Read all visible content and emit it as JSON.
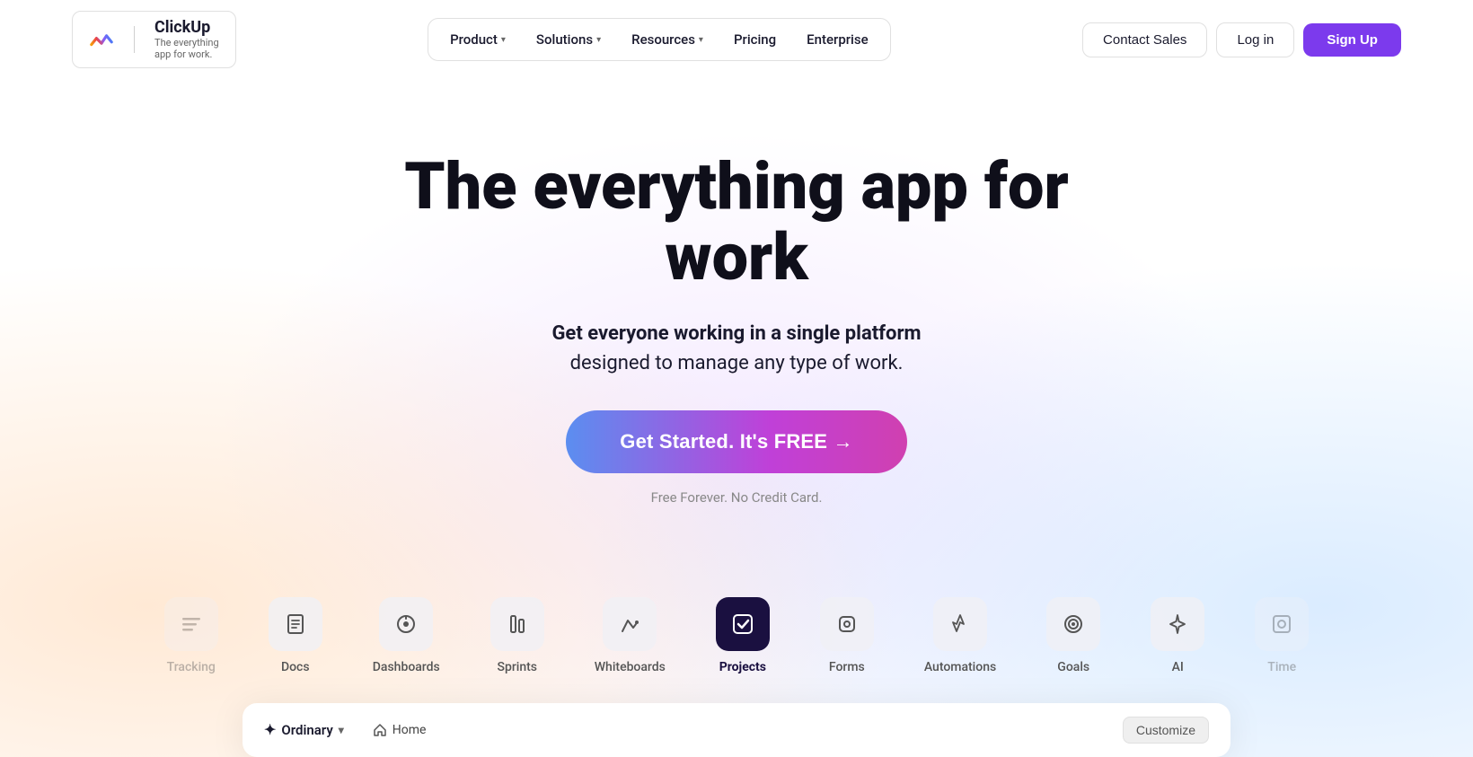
{
  "nav": {
    "logo": {
      "name": "ClickUp",
      "tagline_line1": "The everything",
      "tagline_line2": "app for work."
    },
    "items": [
      {
        "label": "Product",
        "has_dropdown": true
      },
      {
        "label": "Solutions",
        "has_dropdown": true
      },
      {
        "label": "Resources",
        "has_dropdown": true
      },
      {
        "label": "Pricing",
        "has_dropdown": false
      },
      {
        "label": "Enterprise",
        "has_dropdown": false
      }
    ],
    "buttons": {
      "contact": "Contact Sales",
      "login": "Log in",
      "signup": "Sign Up"
    }
  },
  "hero": {
    "title": "The everything app for work",
    "subtitle_strong": "Get everyone working in a single platform",
    "subtitle_rest": "designed to manage any type of work.",
    "cta_label": "Get Started. It's FREE →",
    "fine_print": "Free Forever. No Credit Card."
  },
  "feature_tabs": [
    {
      "id": "tracking",
      "label": "Tracking",
      "icon": "≡",
      "active": false,
      "partial": "left"
    },
    {
      "id": "docs",
      "label": "Docs",
      "icon": "📄",
      "active": false,
      "partial": false
    },
    {
      "id": "dashboards",
      "label": "Dashboards",
      "icon": "🎧",
      "active": false,
      "partial": false
    },
    {
      "id": "sprints",
      "label": "Sprints",
      "icon": "⊶",
      "active": false,
      "partial": false
    },
    {
      "id": "whiteboards",
      "label": "Whiteboards",
      "icon": "✏",
      "active": false,
      "partial": false
    },
    {
      "id": "projects",
      "label": "Projects",
      "icon": "✓",
      "active": true,
      "partial": false
    },
    {
      "id": "forms",
      "label": "Forms",
      "icon": "⊙",
      "active": false,
      "partial": false
    },
    {
      "id": "automations",
      "label": "Automations",
      "icon": "⚡",
      "active": false,
      "partial": false
    },
    {
      "id": "goals",
      "label": "Goals",
      "icon": "◎",
      "active": false,
      "partial": false
    },
    {
      "id": "ai",
      "label": "AI",
      "icon": "✦",
      "active": false,
      "partial": false
    },
    {
      "id": "time",
      "label": "Time",
      "icon": "⊡",
      "active": false,
      "partial": "right"
    }
  ],
  "preview": {
    "logo_label": "Ordinary",
    "nav_item": "Home",
    "customize_label": "Customize"
  }
}
